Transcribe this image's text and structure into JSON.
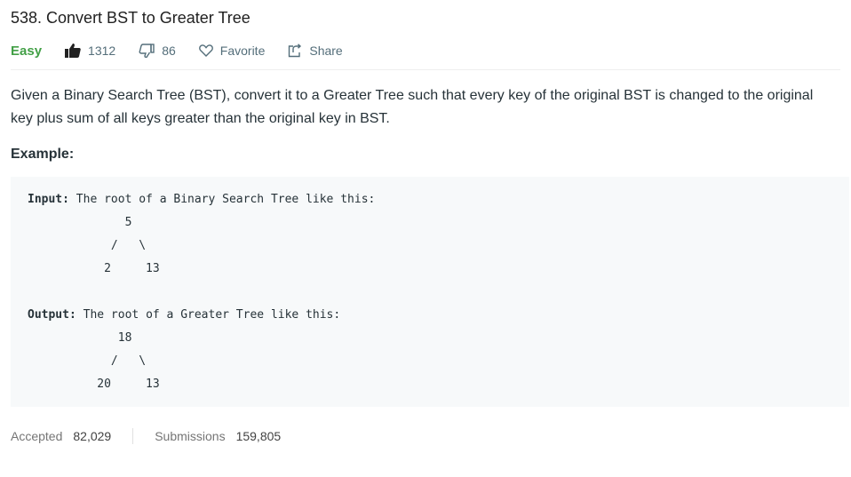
{
  "problem": {
    "title": "538. Convert BST to Greater Tree",
    "difficulty": "Easy",
    "likes": "1312",
    "dislikes": "86",
    "favorite_label": "Favorite",
    "share_label": "Share"
  },
  "description": "Given a Binary Search Tree (BST), convert it to a Greater Tree such that every key of the original BST is changed to the original key plus sum of all keys greater than the original key in BST.",
  "example": {
    "heading": "Example:",
    "input_label": "Input:",
    "input_text": " The root of a Binary Search Tree like this:",
    "input_tree": "              5\n            /   \\\n           2     13",
    "output_label": "Output:",
    "output_text": " The root of a Greater Tree like this:",
    "output_tree": "             18\n            /   \\\n          20     13"
  },
  "stats": {
    "accepted_label": "Accepted",
    "accepted_value": "82,029",
    "submissions_label": "Submissions",
    "submissions_value": "159,805"
  },
  "colors": {
    "easy": "#43a047",
    "meta": "#546e7a"
  }
}
